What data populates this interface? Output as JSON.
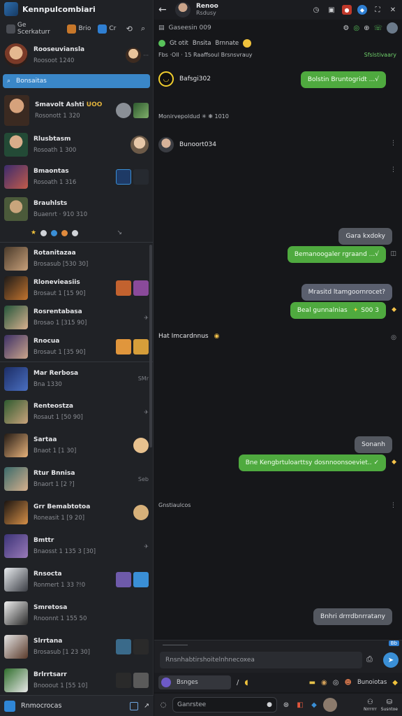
{
  "window": {
    "title": "Kennpulcombiari"
  },
  "left_toolbar": {
    "filter_label": "Ge Scerkaturr",
    "chip1_label": "Brio",
    "chip2_label": "Cr"
  },
  "pinned_chat": {
    "name": "Rooseuviansla",
    "sub": "Roosoot 1240"
  },
  "search": {
    "label": "Bonsaitas"
  },
  "chats_top": [
    {
      "name": "Smavolt Ashti",
      "tag": "UOO",
      "sub": "Rosonott 1 320"
    },
    {
      "name": "Rlusbtasm",
      "tag": "",
      "sub": "Rosoath 1 300"
    },
    {
      "name": "Bmaontas",
      "tag": "",
      "sub": "Rosoath 1 316"
    },
    {
      "name": "Brauhlsts",
      "tag": "",
      "sub": "Buaenrt · 910 310"
    }
  ],
  "reactions": {
    "star": "★",
    "count": ""
  },
  "chats_bottom": [
    {
      "name": "Rotanitazaa",
      "sub": "Brosasub [530 30]",
      "time": ""
    },
    {
      "name": "Rlonevieasiis",
      "sub": "Brosaut 1 [15 90]",
      "time": ""
    },
    {
      "name": "Rosrentabasa",
      "sub": "Brosao 1 [315 90]",
      "time": "✈"
    },
    {
      "name": "Rnocua",
      "sub": "Brosaut 1 [35 90]",
      "time": ""
    },
    {
      "name": "Mar Rerbosa",
      "sub": "Bna 1330",
      "time": "SMr"
    },
    {
      "name": "Renteostza",
      "sub": "Rosaut 1 [50 90]",
      "time": "✈"
    },
    {
      "name": "Sartaa",
      "sub": "Bnaot 1 [1 30]",
      "time": ""
    },
    {
      "name": "Rtur Bnnisa",
      "sub": "Bnaort 1 [2 ?]",
      "time": "Seb"
    },
    {
      "name": "Grr Bemabtotoa",
      "sub": "Roneasit 1 [9 20]",
      "time": ""
    },
    {
      "name": "Bmttr",
      "sub": "Bnaosst 1 135 3 [30]",
      "time": "✈"
    },
    {
      "name": "Rnsocta",
      "sub": "Ronmert 1 33 ?!0",
      "time": ""
    },
    {
      "name": "Smretosa",
      "sub": "Rnoonnt 1 155 50",
      "time": ""
    },
    {
      "name": "Slrrtana",
      "sub": "Brosasub [1 23 30]",
      "time": ""
    },
    {
      "name": "Brlrrtsarr",
      "sub": "Bnooout 1 [55 10]",
      "time": ""
    }
  ],
  "left_footer": {
    "label": "Rnmocrocas"
  },
  "conversation": {
    "contact_name": "Renoo",
    "contact_status": "Rsdusy",
    "sub_label": "Gaseesin 009",
    "meta": [
      "Gt otit",
      "Bnsita",
      "Brnnate"
    ],
    "header_ts": "Fbs ·Oll · 15 Raaffsoul Brsnsvrauy",
    "header_ts_right": "Sfslstivaary",
    "messages": [
      {
        "type": "out",
        "text": "Bolstin Bruntogridt ...√"
      },
      {
        "type": "in_badge",
        "text": "Bafsgi302"
      },
      {
        "type": "ts",
        "text": "Monirvepoldud ✳ ❋ 1010"
      },
      {
        "type": "in_face",
        "text": "Bunoort034"
      },
      {
        "type": "gray",
        "text": "Gara kxdoky"
      },
      {
        "type": "out",
        "text": "Bemanoogaler rgraand ...√"
      },
      {
        "type": "purple",
        "text": "Mrasitd ltamgoornrocet?"
      },
      {
        "type": "out",
        "text": "Beal gunnalnias",
        "extra": "S00 3"
      },
      {
        "type": "in_emoji",
        "text": "Hat Imcardnnus",
        "emoji": "◉"
      },
      {
        "type": "gray",
        "text": "Sonanh"
      },
      {
        "type": "out",
        "text": "Bne Kengbrtuloarttsy dosnnoonsoeviet.. ✓"
      },
      {
        "type": "ts",
        "text": "Gnstiaulcos"
      },
      {
        "type": "gray",
        "text": "Bnhri drrrdbnrratany"
      }
    ]
  },
  "composer": {
    "placeholder": "Rnsnhabtirshoitelnhnecoxea",
    "badge": "Bb"
  },
  "tray": {
    "pill_label": "Bsnges",
    "right_label": "Bunoiotas"
  },
  "bottom": {
    "query": "Ganrstee",
    "col1": "Nrrrrrr",
    "col2": "Susntoe"
  }
}
